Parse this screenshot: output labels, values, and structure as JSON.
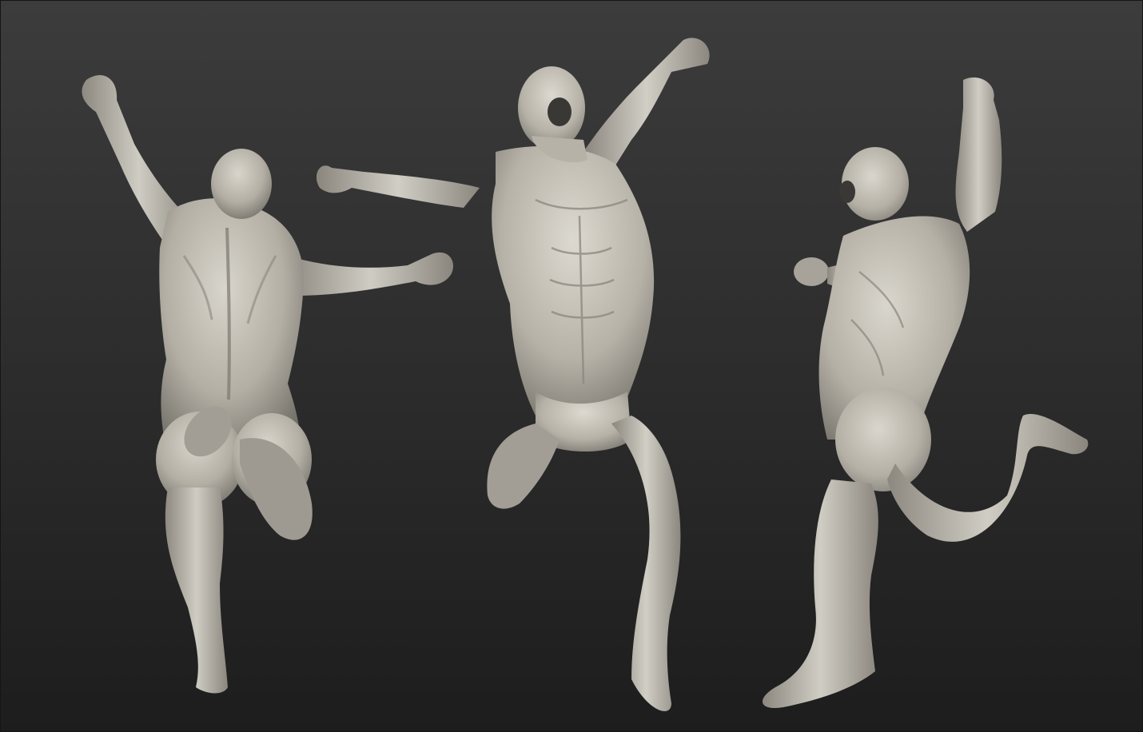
{
  "scene": {
    "background_top": "#3c3c3c",
    "background_bottom": "#1d1d1d",
    "clay_light": "#d4d1c8",
    "clay_mid": "#aaa69c",
    "clay_dark": "#5e5b55",
    "figures": [
      {
        "view": "back"
      },
      {
        "view": "front"
      },
      {
        "view": "side"
      }
    ]
  }
}
